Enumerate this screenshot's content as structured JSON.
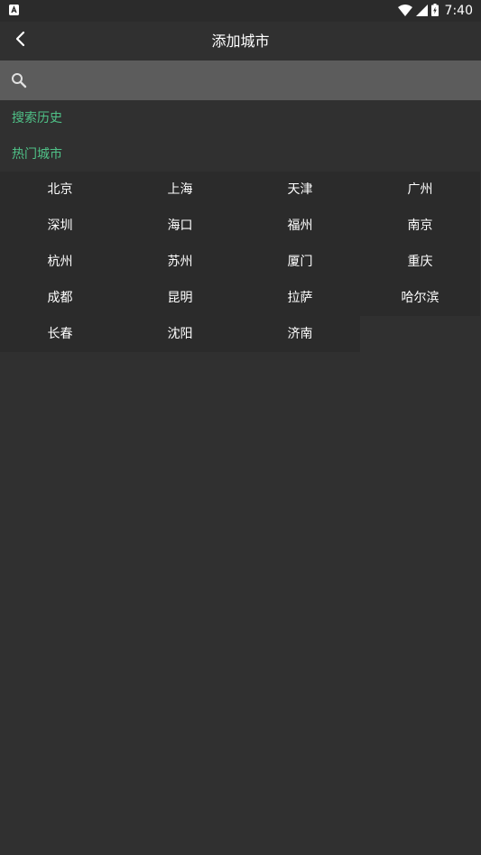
{
  "status_bar": {
    "time": "7:40",
    "icons": [
      "notification-a-icon",
      "wifi-icon",
      "cell-signal-icon",
      "battery-charging-icon"
    ]
  },
  "header": {
    "title": "添加城市",
    "back_icon": "chevron-left-icon"
  },
  "search": {
    "icon": "search-icon",
    "placeholder": "",
    "value": ""
  },
  "sections": {
    "history_title": "搜索历史",
    "hot_title": "热门城市"
  },
  "hot_cities": [
    "北京",
    "上海",
    "天津",
    "广州",
    "深圳",
    "海口",
    "福州",
    "南京",
    "杭州",
    "苏州",
    "厦门",
    "重庆",
    "成都",
    "昆明",
    "拉萨",
    "哈尔滨",
    "长春",
    "沈阳",
    "济南"
  ],
  "colors": {
    "background": "#303030",
    "search_bar": "#5c5c5c",
    "section_title": "#4fc187",
    "city_cell": "#2b2b2b",
    "text": "#ffffff"
  }
}
